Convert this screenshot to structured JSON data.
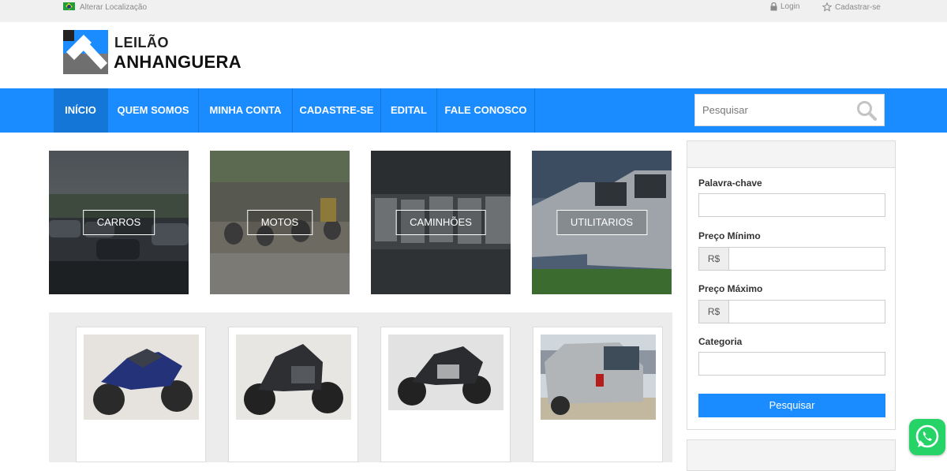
{
  "topbar": {
    "location_link": "Alterar Localização",
    "login": "Login",
    "register": "Cadastrar-se"
  },
  "logo": {
    "line1": "LEILÃO",
    "line2": "ANHANGUERA"
  },
  "nav": {
    "items": [
      {
        "label": "INÍCIO",
        "active": true
      },
      {
        "label": "QUEM SOMOS"
      },
      {
        "label": "MINHA CONTA"
      },
      {
        "label": "CADASTRE-SE"
      },
      {
        "label": "EDITAL"
      },
      {
        "label": "FALE CONOSCO"
      }
    ],
    "search_placeholder": "Pesquisar"
  },
  "categories": [
    {
      "label": "CARROS"
    },
    {
      "label": "MOTOS"
    },
    {
      "label": "CAMINHÕES"
    },
    {
      "label": "UTILITARIOS"
    }
  ],
  "filter": {
    "keyword_label": "Palavra-chave",
    "min_price_label": "Preço Mínimo",
    "max_price_label": "Preço Máximo",
    "currency": "R$",
    "category_label": "Categoria",
    "search_button": "Pesquisar"
  },
  "colors": {
    "accent": "#1a8cff",
    "whatsapp": "#25d366"
  },
  "icons": [
    "brazil-flag-icon",
    "lock-icon",
    "star-icon",
    "search-icon",
    "whatsapp-icon"
  ]
}
